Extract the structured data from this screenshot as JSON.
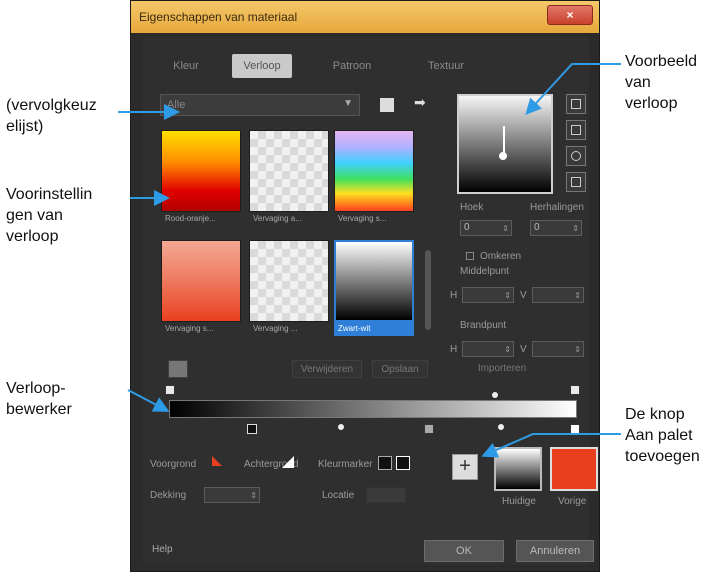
{
  "dialog": {
    "title": "Eigenschappen van materiaal",
    "close_label": "×",
    "tabs": [
      "Kleur",
      "Verloop",
      "Patroon",
      "Textuur"
    ],
    "active_tab": "Verloop",
    "preset_combo": "Alle",
    "presets": [
      {
        "label": "Rood-oranje..."
      },
      {
        "label": "Vervaging a..."
      },
      {
        "label": "Vervaging s..."
      },
      {
        "label": "Vervaging s..."
      },
      {
        "label": "Vervaging ..."
      },
      {
        "label": "Zwart-wit",
        "selected": true
      }
    ],
    "angle_label": "Hoek",
    "angle_value": "0",
    "repeats_label": "Herhalingen",
    "repeats_value": "0",
    "invert_label": "Omkeren",
    "center_label": "Middelpunt",
    "focal_label": "Brandpunt",
    "h_label": "H",
    "v_label": "V",
    "h_value": "",
    "v_value": "",
    "buttons_row": [
      "Verwijderen",
      "Opslaan",
      "Importeren"
    ],
    "foreground_label": "Voorgrond",
    "background_label": "Achtergrond",
    "stop_color_label": "Kleurmarker",
    "opacity_label": "Dekking",
    "opacity_value": "",
    "location_label": "Locatie",
    "location_value": "",
    "current_label": "Huidige",
    "previous_label": "Vorige",
    "help_label": "Help",
    "ok_label": "OK",
    "cancel_label": "Annuleren"
  },
  "annotations": {
    "dropdown": "(vervolgkeuz\nelijst)",
    "presets": "Voorinstellin\ngen van\nverloop",
    "editor": "Verloop-\nbewerker",
    "preview": "Voorbeeld\nvan\nverloop",
    "add_button": "De knop\nAan palet\ntoevoegen"
  },
  "colors": {
    "accent": "#2e9be6",
    "title_bar": "#f0b84c",
    "previous_swatch": "#e8401e",
    "selected_preset": "#2e7fd8"
  }
}
